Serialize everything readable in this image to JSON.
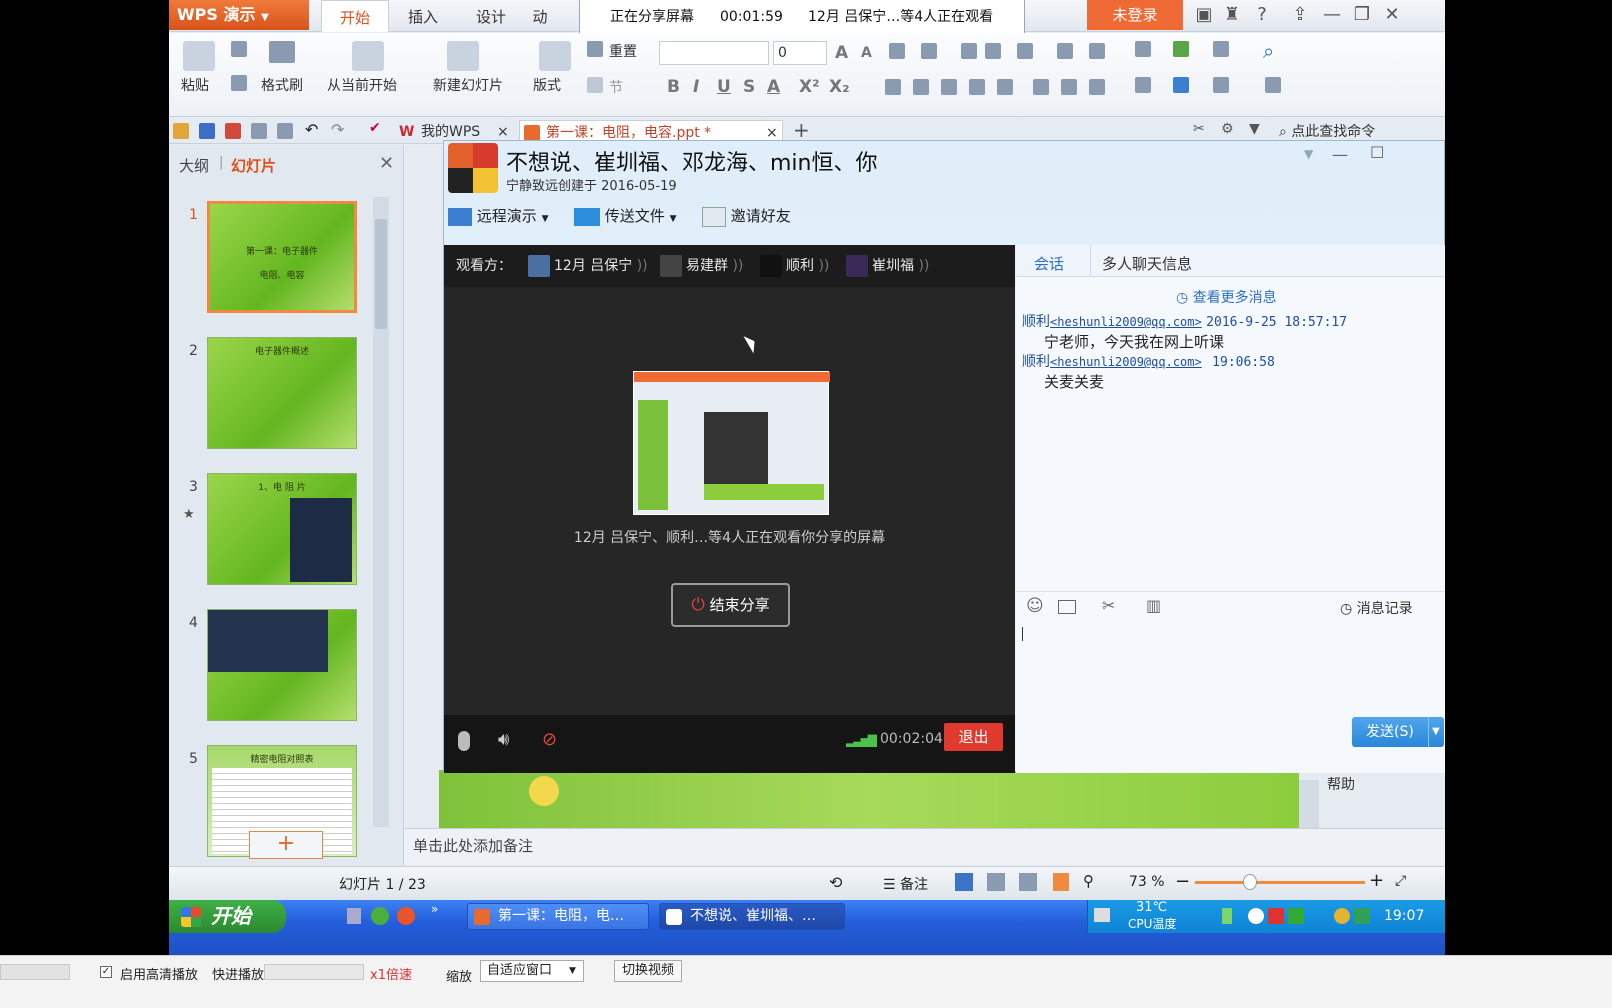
{
  "wps": {
    "app_title": "WPS 演示",
    "menu_tabs": [
      "开始",
      "插入",
      "设计",
      "动"
    ],
    "not_logged_in": "未登录",
    "ribbon": {
      "paste": "粘贴",
      "format_painter": "格式刷",
      "from_current": "从当前开始",
      "new_slide": "新建幻灯片",
      "layout": "版式",
      "reset": "重置",
      "section": "节",
      "font_size": "0",
      "search_command": "点此查找命令"
    },
    "doc_tabs": [
      "我的WPS",
      "第一课：电阻，电容.ppt *"
    ],
    "left_panel": {
      "tab_outline": "大纲",
      "tab_slides": "幻灯片",
      "slides": [
        {
          "num": "1",
          "title": "第一课：电子器件",
          "sub": "电阻、电容"
        },
        {
          "num": "2",
          "title": "电子器件概述",
          "sub": ""
        },
        {
          "num": "3",
          "title": "1、电 阻 片",
          "sub": ""
        },
        {
          "num": "4",
          "title": "",
          "sub": ""
        },
        {
          "num": "5",
          "title": "精密电阻对照表",
          "sub": ""
        }
      ],
      "add_symbol": "+"
    },
    "notes_placeholder": "单击此处添加备注",
    "status": {
      "slide_counter": "幻灯片 1 / 23",
      "notes": "备注",
      "zoom": "73 %"
    }
  },
  "share_banner": {
    "status": "正在分享屏幕",
    "timer": "00:01:59",
    "viewers_text": "12月 吕保宁…等4人正在观看"
  },
  "qq": {
    "title": "不想说、崔圳福、邓龙海、min恒、你",
    "subtitle": "宁静致远创建于 2016-05-19",
    "toolbar": [
      "远程演示",
      "传送文件",
      "邀请好友"
    ],
    "viewers_label": "观看方：",
    "viewers": [
      "12月 吕保宁",
      "易建群",
      "顺利",
      "崔圳福"
    ],
    "watching_text": "12月 吕保宁、顺利…等4人正在观看你分享的屏幕",
    "end_share": "结束分享",
    "call_timer": "00:02:04",
    "exit": "退出",
    "chat_tabs": [
      "会话",
      "多人聊天信息"
    ],
    "more_messages": "查看更多消息",
    "messages": [
      {
        "name": "顺利",
        "email": "<heshunli2009@qq.com>",
        "time": "2016-9-25 18:57:17",
        "text": "宁老师，今天我在网上听课"
      },
      {
        "name": "顺利",
        "email": "<heshunli2009@qq.com>",
        "time": "19:06:58",
        "text": "关麦关麦"
      }
    ],
    "history": "消息记录",
    "send": "发送(S)",
    "help": "帮助"
  },
  "taskbar": {
    "start": "开始",
    "tasks": [
      "第一课：电阻，电…",
      "不想说、崔圳福、…"
    ],
    "temp": "31℃",
    "temp_label": "CPU温度",
    "clock": "19:07"
  },
  "player": {
    "hd_label": "启用高清播放",
    "hd_checked": true,
    "fast_forward": "快进播放",
    "speed": "x1倍速",
    "zoom_label": "缩放",
    "zoom_value": "自适应窗口",
    "switch_video": "切换视频"
  }
}
